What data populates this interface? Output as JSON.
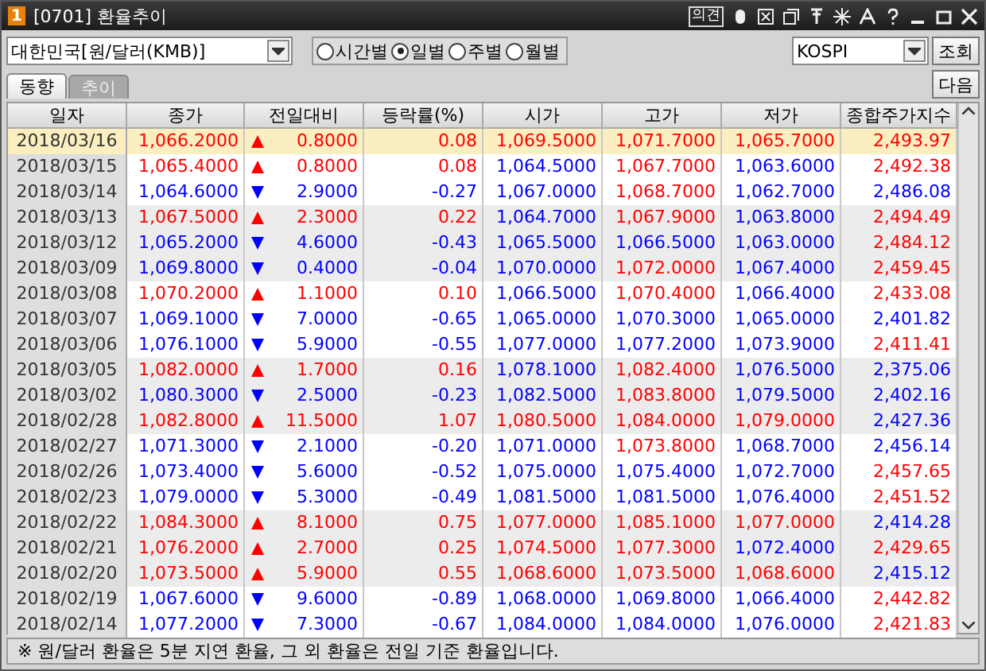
{
  "window": {
    "badge": "1",
    "title": "[0701] 환율추이",
    "toolbar_label": "의견"
  },
  "filter": {
    "currency": "대한민국[원/달러(KMB)]",
    "periods": [
      {
        "label": "시간별",
        "selected": false
      },
      {
        "label": "일별",
        "selected": true
      },
      {
        "label": "주별",
        "selected": false
      },
      {
        "label": "월별",
        "selected": false
      }
    ],
    "index": "KOSPI",
    "query_button": "조회"
  },
  "tabs": [
    {
      "label": "동향",
      "selected": true
    },
    {
      "label": "추이",
      "selected": false
    }
  ],
  "next_button": "다음",
  "table": {
    "columns": [
      "일자",
      "종가",
      "전일대비",
      "등락률(%)",
      "시가",
      "고가",
      "저가",
      "종합주가지수"
    ],
    "rows": [
      {
        "selected": true,
        "cells": [
          {
            "text": "2018/03/16"
          },
          {
            "text": "1,066.2000",
            "up": true
          },
          {
            "text": "0.8000",
            "up": true
          },
          {
            "text": "0.08",
            "up": true
          },
          {
            "text": "1,069.5000",
            "up": true
          },
          {
            "text": "1,071.7000",
            "up": true
          },
          {
            "text": "1,065.7000",
            "up": true
          },
          {
            "text": "2,493.97",
            "up": true
          }
        ]
      },
      {
        "selected": false,
        "cells": [
          {
            "text": "2018/03/15"
          },
          {
            "text": "1,065.4000",
            "up": true
          },
          {
            "text": "0.8000",
            "up": true
          },
          {
            "text": "0.08",
            "up": true
          },
          {
            "text": "1,064.5000",
            "up": false
          },
          {
            "text": "1,067.7000",
            "up": true
          },
          {
            "text": "1,063.6000",
            "up": false
          },
          {
            "text": "2,492.38",
            "up": true
          }
        ]
      },
      {
        "selected": false,
        "cells": [
          {
            "text": "2018/03/14"
          },
          {
            "text": "1,064.6000",
            "up": false
          },
          {
            "text": "2.9000",
            "up": false
          },
          {
            "text": "-0.27",
            "up": false
          },
          {
            "text": "1,067.0000",
            "up": false
          },
          {
            "text": "1,068.7000",
            "up": true
          },
          {
            "text": "1,062.7000",
            "up": false
          },
          {
            "text": "2,486.08",
            "up": false
          }
        ]
      },
      {
        "selected": false,
        "cells": [
          {
            "text": "2018/03/13"
          },
          {
            "text": "1,067.5000",
            "up": true
          },
          {
            "text": "2.3000",
            "up": true
          },
          {
            "text": "0.22",
            "up": true
          },
          {
            "text": "1,064.7000",
            "up": false
          },
          {
            "text": "1,067.9000",
            "up": true
          },
          {
            "text": "1,063.8000",
            "up": false
          },
          {
            "text": "2,494.49",
            "up": true
          }
        ]
      },
      {
        "selected": false,
        "cells": [
          {
            "text": "2018/03/12"
          },
          {
            "text": "1,065.2000",
            "up": false
          },
          {
            "text": "4.6000",
            "up": false
          },
          {
            "text": "-0.43",
            "up": false
          },
          {
            "text": "1,065.5000",
            "up": false
          },
          {
            "text": "1,066.5000",
            "up": false
          },
          {
            "text": "1,063.0000",
            "up": false
          },
          {
            "text": "2,484.12",
            "up": true
          }
        ]
      },
      {
        "selected": false,
        "cells": [
          {
            "text": "2018/03/09"
          },
          {
            "text": "1,069.8000",
            "up": false
          },
          {
            "text": "0.4000",
            "up": false
          },
          {
            "text": "-0.04",
            "up": false
          },
          {
            "text": "1,070.0000",
            "up": false
          },
          {
            "text": "1,072.0000",
            "up": true
          },
          {
            "text": "1,067.4000",
            "up": false
          },
          {
            "text": "2,459.45",
            "up": true
          }
        ]
      },
      {
        "selected": false,
        "cells": [
          {
            "text": "2018/03/08"
          },
          {
            "text": "1,070.2000",
            "up": true
          },
          {
            "text": "1.1000",
            "up": true
          },
          {
            "text": "0.10",
            "up": true
          },
          {
            "text": "1,066.5000",
            "up": false
          },
          {
            "text": "1,070.4000",
            "up": true
          },
          {
            "text": "1,066.4000",
            "up": false
          },
          {
            "text": "2,433.08",
            "up": true
          }
        ]
      },
      {
        "selected": false,
        "cells": [
          {
            "text": "2018/03/07"
          },
          {
            "text": "1,069.1000",
            "up": false
          },
          {
            "text": "7.0000",
            "up": false
          },
          {
            "text": "-0.65",
            "up": false
          },
          {
            "text": "1,065.0000",
            "up": false
          },
          {
            "text": "1,070.3000",
            "up": false
          },
          {
            "text": "1,065.0000",
            "up": false
          },
          {
            "text": "2,401.82",
            "up": false
          }
        ]
      },
      {
        "selected": false,
        "cells": [
          {
            "text": "2018/03/06"
          },
          {
            "text": "1,076.1000",
            "up": false
          },
          {
            "text": "5.9000",
            "up": false
          },
          {
            "text": "-0.55",
            "up": false
          },
          {
            "text": "1,077.0000",
            "up": false
          },
          {
            "text": "1,077.2000",
            "up": false
          },
          {
            "text": "1,073.9000",
            "up": false
          },
          {
            "text": "2,411.41",
            "up": true
          }
        ]
      },
      {
        "selected": false,
        "cells": [
          {
            "text": "2018/03/05"
          },
          {
            "text": "1,082.0000",
            "up": true
          },
          {
            "text": "1.7000",
            "up": true
          },
          {
            "text": "0.16",
            "up": true
          },
          {
            "text": "1,078.1000",
            "up": false
          },
          {
            "text": "1,082.4000",
            "up": true
          },
          {
            "text": "1,076.5000",
            "up": false
          },
          {
            "text": "2,375.06",
            "up": false
          }
        ]
      },
      {
        "selected": false,
        "cells": [
          {
            "text": "2018/03/02"
          },
          {
            "text": "1,080.3000",
            "up": false
          },
          {
            "text": "2.5000",
            "up": false
          },
          {
            "text": "-0.23",
            "up": false
          },
          {
            "text": "1,082.5000",
            "up": false
          },
          {
            "text": "1,083.8000",
            "up": true
          },
          {
            "text": "1,079.5000",
            "up": false
          },
          {
            "text": "2,402.16",
            "up": false
          }
        ]
      },
      {
        "selected": false,
        "cells": [
          {
            "text": "2018/02/28"
          },
          {
            "text": "1,082.8000",
            "up": true
          },
          {
            "text": "11.5000",
            "up": true
          },
          {
            "text": "1.07",
            "up": true
          },
          {
            "text": "1,080.5000",
            "up": true
          },
          {
            "text": "1,084.0000",
            "up": true
          },
          {
            "text": "1,079.0000",
            "up": true
          },
          {
            "text": "2,427.36",
            "up": false
          }
        ]
      },
      {
        "selected": false,
        "cells": [
          {
            "text": "2018/02/27"
          },
          {
            "text": "1,071.3000",
            "up": false
          },
          {
            "text": "2.1000",
            "up": false
          },
          {
            "text": "-0.20",
            "up": false
          },
          {
            "text": "1,071.0000",
            "up": false
          },
          {
            "text": "1,073.8000",
            "up": true
          },
          {
            "text": "1,068.7000",
            "up": false
          },
          {
            "text": "2,456.14",
            "up": false
          }
        ]
      },
      {
        "selected": false,
        "cells": [
          {
            "text": "2018/02/26"
          },
          {
            "text": "1,073.4000",
            "up": false
          },
          {
            "text": "5.6000",
            "up": false
          },
          {
            "text": "-0.52",
            "up": false
          },
          {
            "text": "1,075.0000",
            "up": false
          },
          {
            "text": "1,075.4000",
            "up": false
          },
          {
            "text": "1,072.7000",
            "up": false
          },
          {
            "text": "2,457.65",
            "up": true
          }
        ]
      },
      {
        "selected": false,
        "cells": [
          {
            "text": "2018/02/23"
          },
          {
            "text": "1,079.0000",
            "up": false
          },
          {
            "text": "5.3000",
            "up": false
          },
          {
            "text": "-0.49",
            "up": false
          },
          {
            "text": "1,081.5000",
            "up": false
          },
          {
            "text": "1,081.5000",
            "up": false
          },
          {
            "text": "1,076.4000",
            "up": false
          },
          {
            "text": "2,451.52",
            "up": true
          }
        ]
      },
      {
        "selected": false,
        "cells": [
          {
            "text": "2018/02/22"
          },
          {
            "text": "1,084.3000",
            "up": true
          },
          {
            "text": "8.1000",
            "up": true
          },
          {
            "text": "0.75",
            "up": true
          },
          {
            "text": "1,077.0000",
            "up": true
          },
          {
            "text": "1,085.1000",
            "up": true
          },
          {
            "text": "1,077.0000",
            "up": true
          },
          {
            "text": "2,414.28",
            "up": false
          }
        ]
      },
      {
        "selected": false,
        "cells": [
          {
            "text": "2018/02/21"
          },
          {
            "text": "1,076.2000",
            "up": true
          },
          {
            "text": "2.7000",
            "up": true
          },
          {
            "text": "0.25",
            "up": true
          },
          {
            "text": "1,074.5000",
            "up": true
          },
          {
            "text": "1,077.3000",
            "up": true
          },
          {
            "text": "1,072.4000",
            "up": false
          },
          {
            "text": "2,429.65",
            "up": true
          }
        ]
      },
      {
        "selected": false,
        "cells": [
          {
            "text": "2018/02/20"
          },
          {
            "text": "1,073.5000",
            "up": true
          },
          {
            "text": "5.9000",
            "up": true
          },
          {
            "text": "0.55",
            "up": true
          },
          {
            "text": "1,068.6000",
            "up": true
          },
          {
            "text": "1,073.5000",
            "up": true
          },
          {
            "text": "1,068.6000",
            "up": true
          },
          {
            "text": "2,415.12",
            "up": false
          }
        ]
      },
      {
        "selected": false,
        "cells": [
          {
            "text": "2018/02/19"
          },
          {
            "text": "1,067.6000",
            "up": false
          },
          {
            "text": "9.6000",
            "up": false
          },
          {
            "text": "-0.89",
            "up": false
          },
          {
            "text": "1,068.0000",
            "up": false
          },
          {
            "text": "1,069.8000",
            "up": false
          },
          {
            "text": "1,066.4000",
            "up": false
          },
          {
            "text": "2,442.82",
            "up": true
          }
        ]
      },
      {
        "selected": false,
        "cells": [
          {
            "text": "2018/02/14"
          },
          {
            "text": "1,077.2000",
            "up": false
          },
          {
            "text": "7.3000",
            "up": false
          },
          {
            "text": "-0.67",
            "up": false
          },
          {
            "text": "1,084.0000",
            "up": false
          },
          {
            "text": "1,084.0000",
            "up": false
          },
          {
            "text": "1,076.0000",
            "up": false
          },
          {
            "text": "2,421.83",
            "up": true
          }
        ]
      }
    ]
  },
  "footer": "※ 원/달러 환율은 5분 지연 환율, 그 외 환율은 전일 기준 환율입니다."
}
